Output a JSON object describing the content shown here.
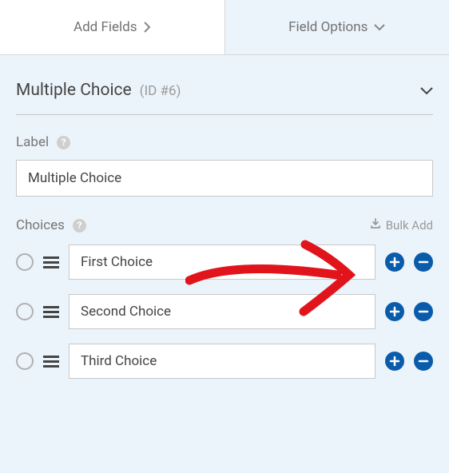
{
  "tabs": {
    "add_fields": "Add Fields",
    "field_options": "Field Options"
  },
  "section": {
    "title": "Multiple Choice",
    "id_label": "(ID #6)"
  },
  "label_field": {
    "label": "Label",
    "value": "Multiple Choice"
  },
  "choices": {
    "label": "Choices",
    "bulk_add": "Bulk Add",
    "items": [
      {
        "value": "First Choice"
      },
      {
        "value": "Second Choice"
      },
      {
        "value": "Third Choice"
      }
    ]
  }
}
